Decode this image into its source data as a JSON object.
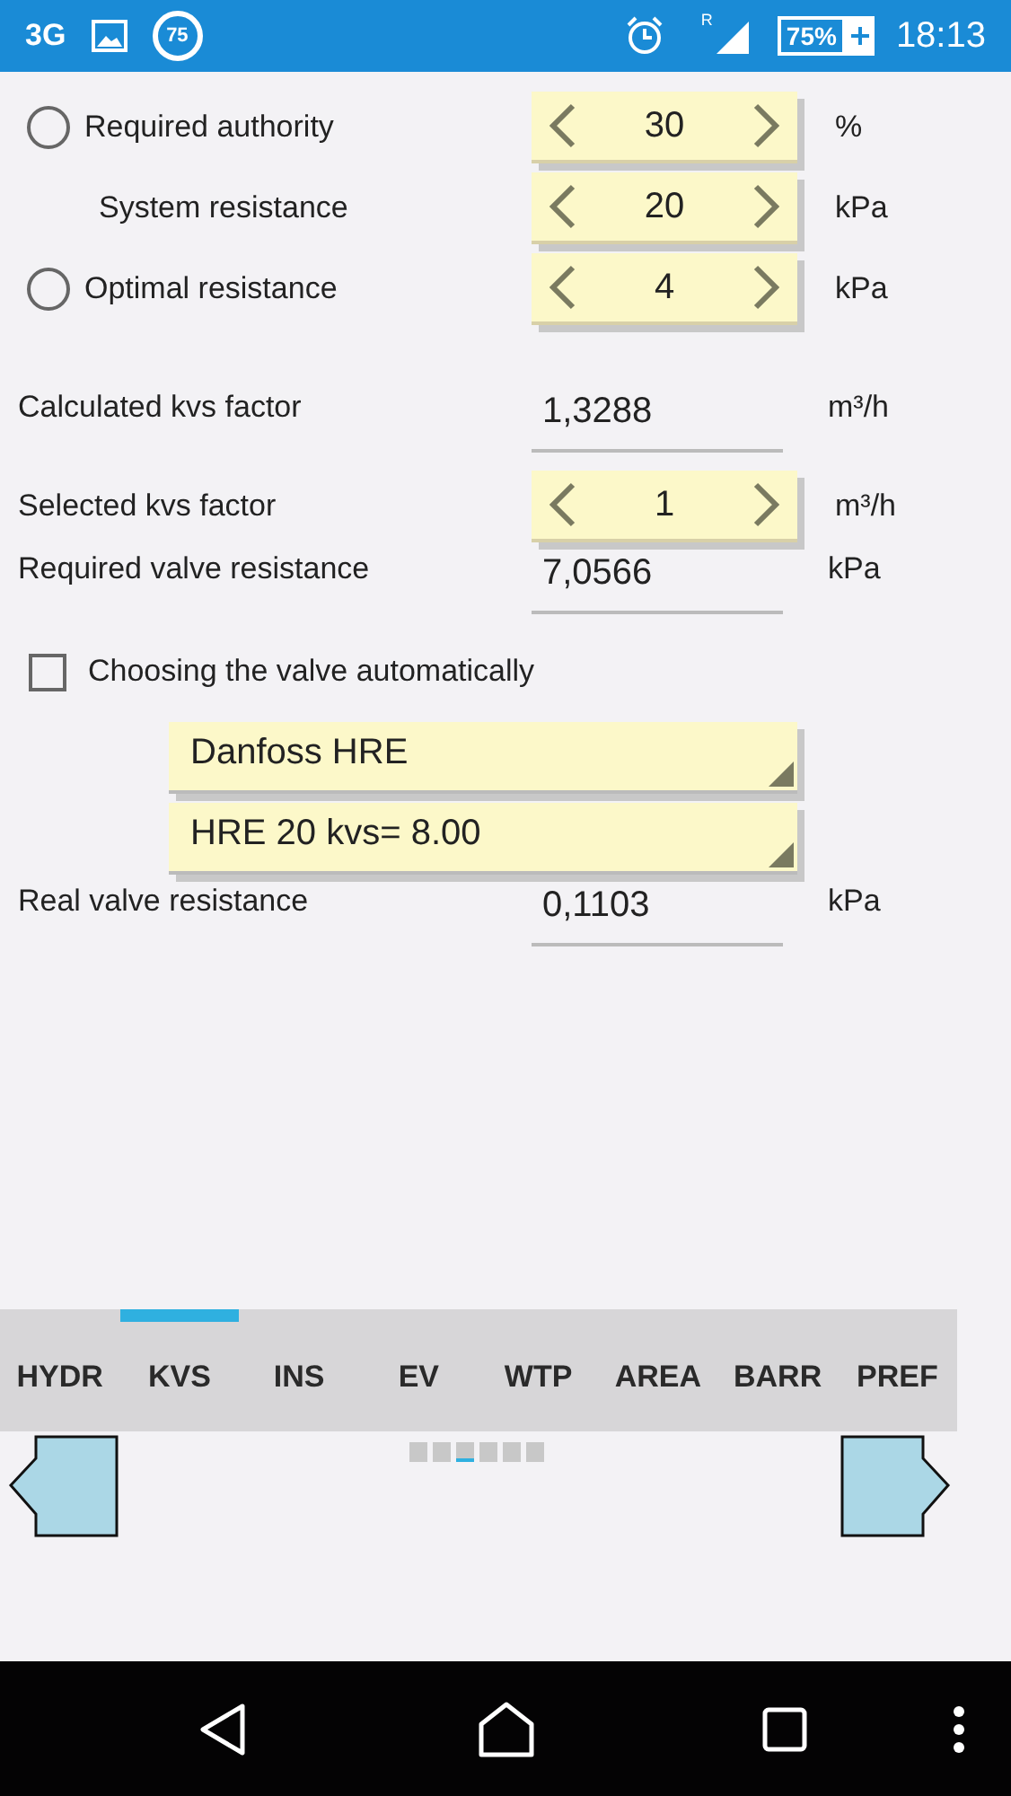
{
  "status_bar": {
    "network": "3G",
    "badge": "75",
    "roaming": "R",
    "battery": "75%",
    "time": "18:13"
  },
  "rows": [
    {
      "kind": "radio_spinner",
      "label": "Required authority",
      "selected": false,
      "value": "30",
      "unit": "%"
    },
    {
      "kind": "spinner",
      "indented": true,
      "label": "System resistance",
      "value": "20",
      "unit": "kPa"
    },
    {
      "kind": "radio_spinner",
      "label": "Optimal resistance",
      "selected": false,
      "value": "4",
      "unit": "kPa"
    },
    {
      "kind": "gap"
    },
    {
      "kind": "output",
      "label": "Calculated kvs factor",
      "value": "1,3288",
      "unit": "m³/h"
    },
    {
      "kind": "spinner",
      "label": "Selected kvs factor",
      "value": "1",
      "unit": "m³/h"
    },
    {
      "kind": "output",
      "label": "Required valve resistance",
      "value": "7,0566",
      "unit": "kPa"
    },
    {
      "kind": "checkbox",
      "label": "Choosing the valve automatically",
      "checked": false
    },
    {
      "kind": "dropdown",
      "value": "Danfoss HRE"
    },
    {
      "kind": "dropdown",
      "value": "HRE 20 kvs= 8.00"
    },
    {
      "kind": "output",
      "label": "Real valve resistance",
      "value": "0,1103",
      "unit": "kPa"
    }
  ],
  "tabs": [
    {
      "label": "HYDR",
      "selected": false
    },
    {
      "label": "KVS",
      "selected": true
    },
    {
      "label": "INS",
      "selected": false
    },
    {
      "label": "EV",
      "selected": false
    },
    {
      "label": "WTP",
      "selected": false
    },
    {
      "label": "AREA",
      "selected": false
    },
    {
      "label": "BARR",
      "selected": false
    },
    {
      "label": "PREF",
      "selected": false
    }
  ],
  "pages": [
    {
      "selected": false
    },
    {
      "selected": false
    },
    {
      "selected": true
    },
    {
      "selected": false
    },
    {
      "selected": false
    },
    {
      "selected": false
    }
  ]
}
